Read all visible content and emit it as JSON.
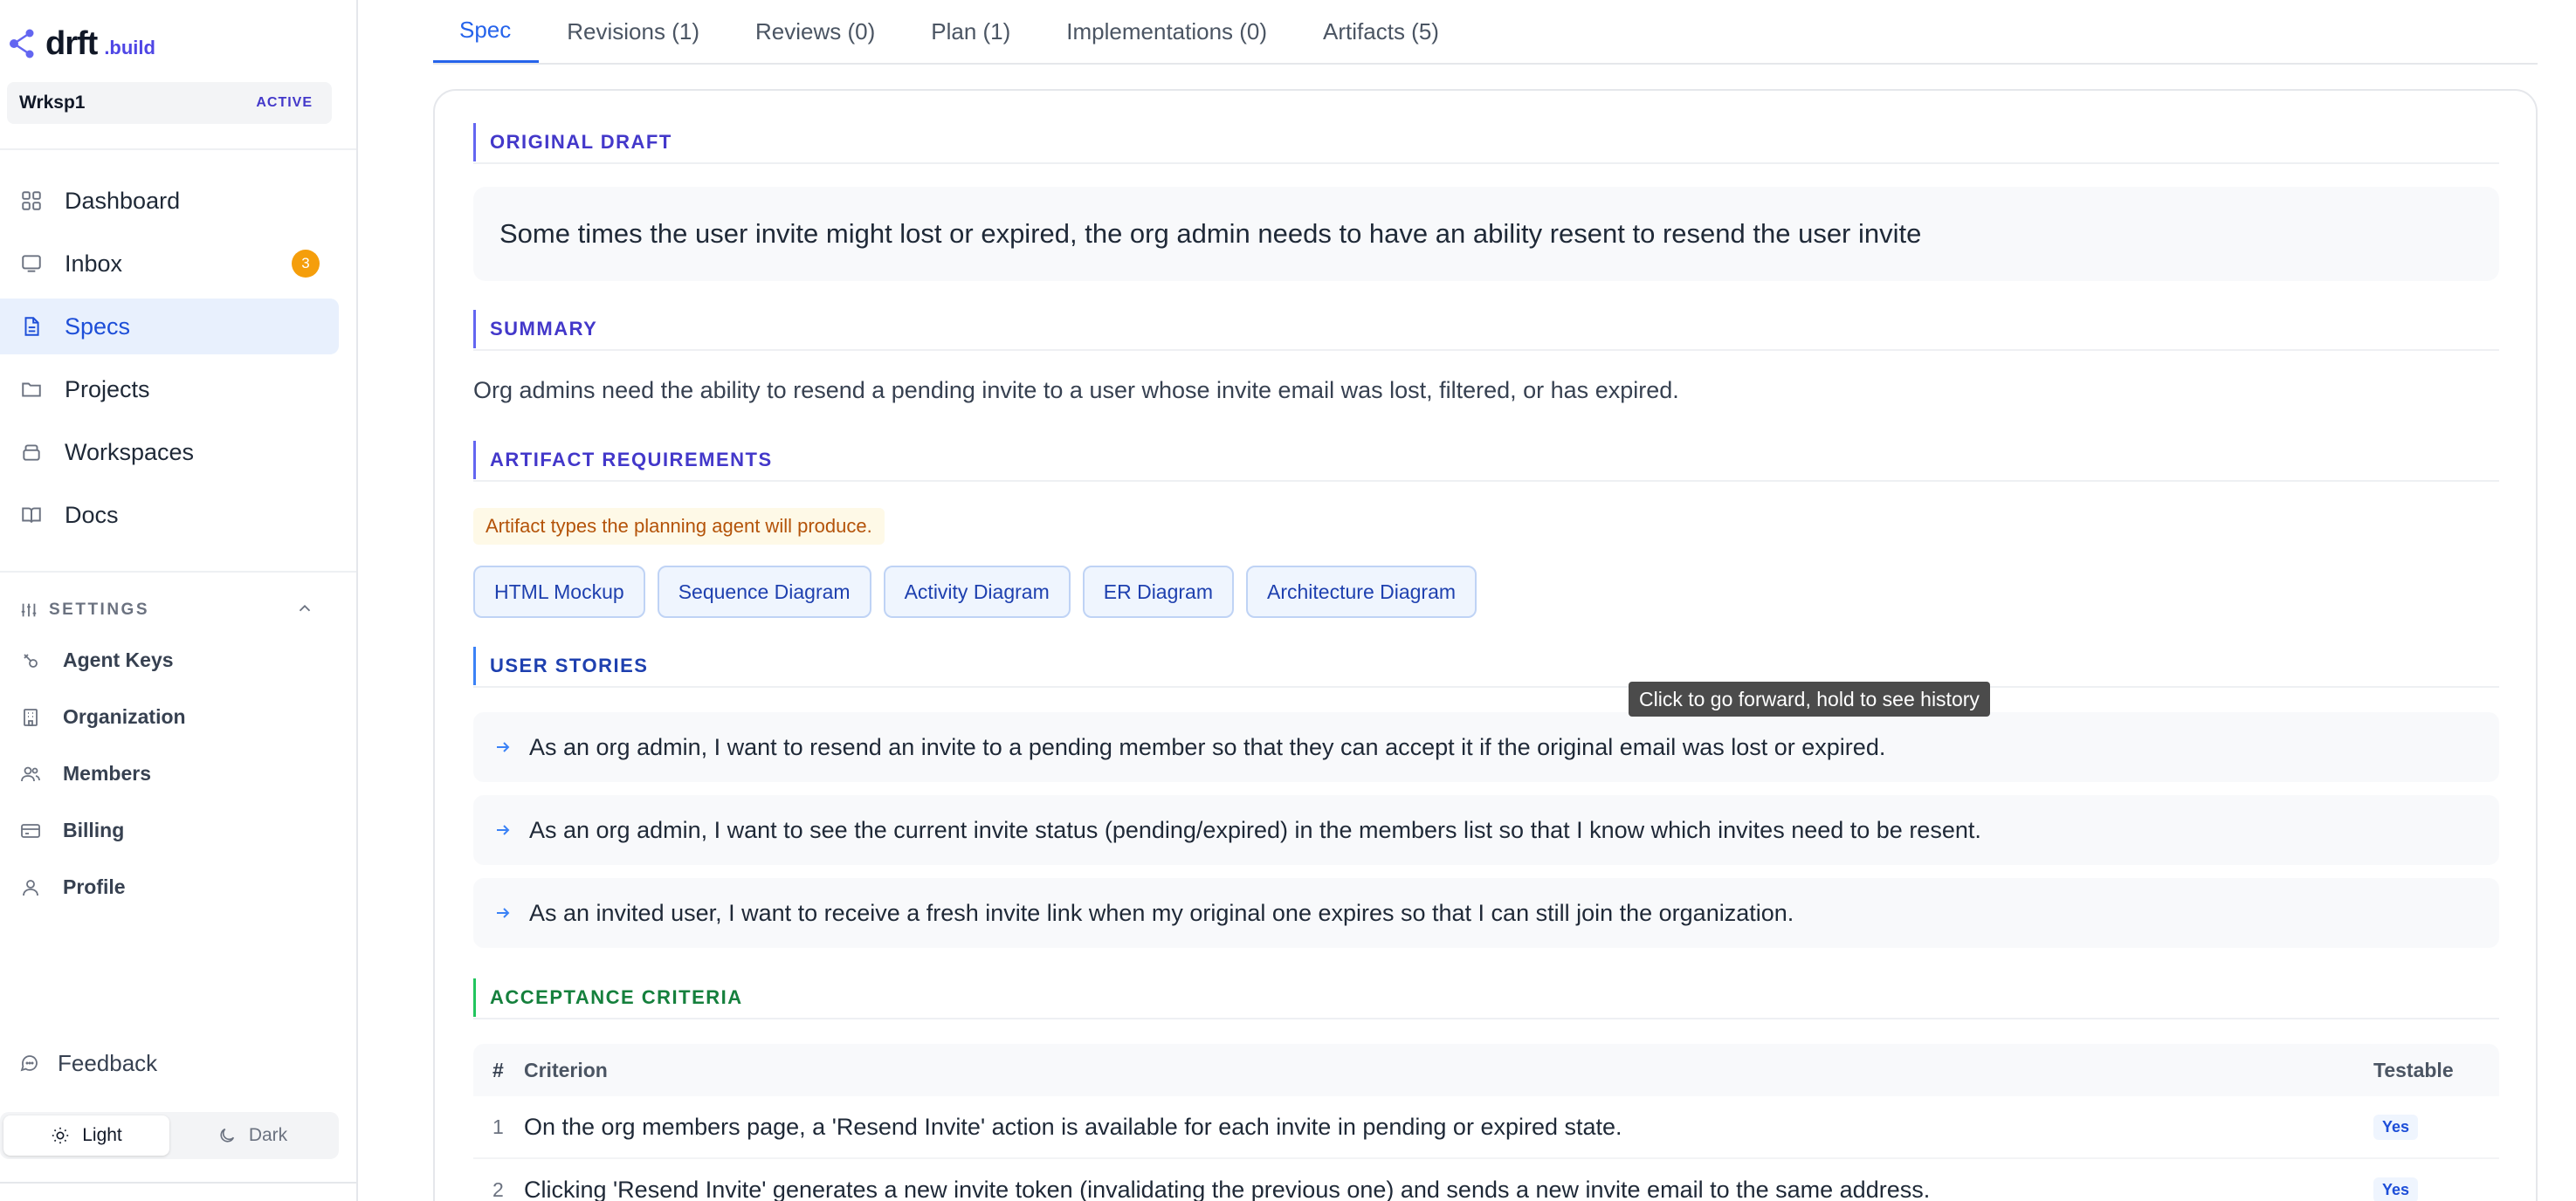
{
  "brand": {
    "name": "drft",
    "sub": ".build"
  },
  "workspace": {
    "name": "Wrksp1",
    "status": "ACTIVE"
  },
  "nav": {
    "items": [
      {
        "label": "Dashboard",
        "icon": "grid-icon"
      },
      {
        "label": "Inbox",
        "icon": "inbox-icon",
        "badge": "3"
      },
      {
        "label": "Specs",
        "icon": "document-icon",
        "active": true
      },
      {
        "label": "Projects",
        "icon": "folder-icon"
      },
      {
        "label": "Workspaces",
        "icon": "layers-icon"
      },
      {
        "label": "Docs",
        "icon": "book-icon"
      }
    ]
  },
  "settings": {
    "title": "SETTINGS",
    "items": [
      {
        "label": "Agent Keys",
        "icon": "key-icon"
      },
      {
        "label": "Organization",
        "icon": "building-icon"
      },
      {
        "label": "Members",
        "icon": "users-icon"
      },
      {
        "label": "Billing",
        "icon": "credit-card-icon"
      },
      {
        "label": "Profile",
        "icon": "user-icon"
      }
    ]
  },
  "feedback": {
    "label": "Feedback"
  },
  "theme": {
    "light_label": "Light",
    "dark_label": "Dark",
    "selected": "Light"
  },
  "tabs": [
    {
      "label": "Spec",
      "active": true
    },
    {
      "label": "Revisions (1)"
    },
    {
      "label": "Reviews (0)"
    },
    {
      "label": "Plan (1)"
    },
    {
      "label": "Implementations (0)"
    },
    {
      "label": "Artifacts (5)"
    }
  ],
  "spec": {
    "original_draft": {
      "title": "ORIGINAL DRAFT",
      "text": "Some times the user invite might lost or expired, the org admin needs to have an ability resent to resend the user invite"
    },
    "summary": {
      "title": "SUMMARY",
      "text": "Org admins need the ability to resend a pending invite to a user whose invite email was lost, filtered, or has expired."
    },
    "artifact_requirements": {
      "title": "ARTIFACT REQUIREMENTS",
      "note": "Artifact types the planning agent will produce.",
      "chips": [
        "HTML Mockup",
        "Sequence Diagram",
        "Activity Diagram",
        "ER Diagram",
        "Architecture Diagram"
      ]
    },
    "user_stories": {
      "title": "USER STORIES",
      "items": [
        "As an org admin, I want to resend an invite to a pending member so that they can accept it if the original email was lost or expired.",
        "As an org admin, I want to see the current invite status (pending/expired) in the members list so that I know which invites need to be resent.",
        "As an invited user, I want to receive a fresh invite link when my original one expires so that I can still join the organization."
      ]
    },
    "acceptance_criteria": {
      "title": "ACCEPTANCE CRITERIA",
      "columns": {
        "num": "#",
        "criterion": "Criterion",
        "testable": "Testable"
      },
      "rows": [
        {
          "num": "1",
          "criterion": "On the org members page, a 'Resend Invite' action is available for each invite in pending or expired state.",
          "testable": "Yes"
        },
        {
          "num": "2",
          "criterion": "Clicking 'Resend Invite' generates a new invite token (invalidating the previous one) and sends a new invite email to the same address.",
          "testable": "Yes"
        }
      ]
    }
  },
  "tooltip": {
    "text": "Click to go forward, hold to see history"
  },
  "colors": {
    "accent": "#2563eb",
    "section_purple": "#4338ca",
    "section_blue": "#1e40af",
    "section_green": "#15803d",
    "badge_orange": "#f59e0b",
    "note_amber": "#b45309"
  }
}
